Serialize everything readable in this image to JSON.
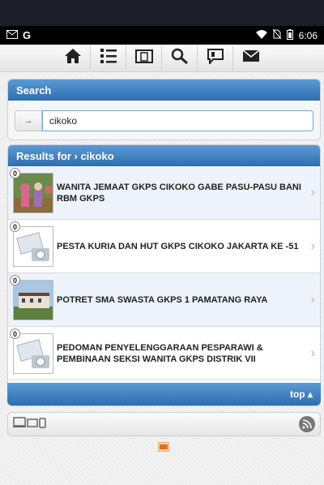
{
  "status_bar": {
    "time": "6:06",
    "icons": [
      "mail-icon",
      "google-icon",
      "wifi-icon",
      "no-sim-icon",
      "battery-icon"
    ]
  },
  "toolbar": {
    "buttons": [
      "home-icon",
      "list-icon",
      "document-icon",
      "search-icon",
      "comment-icon",
      "mail-icon"
    ]
  },
  "search": {
    "heading": "Search",
    "button_label": "→",
    "value": "cikoko"
  },
  "results": {
    "heading": "Results for › cikoko",
    "items": [
      {
        "count": "0",
        "title": "WANITA JEMAAT GKPS CIKOKO GABE PASU-PASU BANI RBM GKPS",
        "thumb": "photo-people"
      },
      {
        "count": "0",
        "title": "PESTA KURIA DAN HUT GKPS CIKOKO JAKARTA KE -51",
        "thumb": "placeholder"
      },
      {
        "count": "0",
        "title": "POTRET SMA SWASTA GKPS 1 PAMATANG RAYA",
        "thumb": "photo-building"
      },
      {
        "count": "0",
        "title": "PEDOMAN PENYELENGGARAAN PESPARAWI & PEMBINAAN SEKSI WANITA GKPS DISTRIK VII",
        "thumb": "placeholder"
      }
    ]
  },
  "top_link": "top",
  "footer": {
    "icons": [
      "devices-icon",
      "rss-icon",
      "pdf-icon"
    ]
  },
  "colors": {
    "header_blue": "#3f7fc1",
    "row_alt": "#eef3fb"
  }
}
